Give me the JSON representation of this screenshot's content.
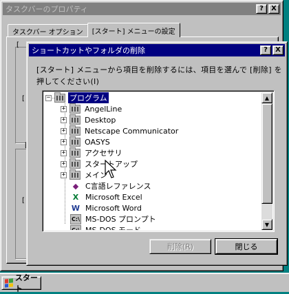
{
  "back_window": {
    "title": "タスクバーのプロパティ",
    "help_btn": "?",
    "close_btn": "X",
    "tabs": [
      {
        "label": "タスクバー オプション",
        "selected": false
      },
      {
        "label": "[スタート] メニューの設定",
        "selected": true
      }
    ],
    "bracket_1": "[",
    "bracket_2": "[",
    "bracket_3": "[",
    "bracket_4": "["
  },
  "dialog": {
    "title": "ショートカットやフォルダの削除",
    "help_btn": "?",
    "close_btn": "X",
    "message": "[スタート] メニューから項目を削除するには、項目を選んで [削除] を押してください(I)",
    "tree_items": [
      {
        "label": "プログラム",
        "expander": "−",
        "icon": "folder-icon",
        "selected": true
      },
      {
        "label": "AngelLine",
        "expander": "+",
        "icon": "folder-icon"
      },
      {
        "label": "Desktop",
        "expander": "+",
        "icon": "folder-icon"
      },
      {
        "label": "Netscape Communicator",
        "expander": "+",
        "icon": "folder-icon"
      },
      {
        "label": "OASYS",
        "expander": "+",
        "icon": "folder-icon"
      },
      {
        "label": "アクセサリ",
        "expander": "+",
        "icon": "folder-icon"
      },
      {
        "label": "スタートアップ",
        "expander": "+",
        "icon": "folder-icon"
      },
      {
        "label": "メイン",
        "expander": "+",
        "icon": "folder-icon"
      },
      {
        "label": "C言語レファレンス",
        "expander": "",
        "icon": "reference-book-icon"
      },
      {
        "label": "Microsoft Excel",
        "expander": "",
        "icon": "excel-icon"
      },
      {
        "label": "Microsoft Word",
        "expander": "",
        "icon": "word-icon"
      },
      {
        "label": "MS-DOS プロンプト",
        "expander": "",
        "icon": "msdos-icon"
      },
      {
        "label": "MS-DOS モード",
        "expander": "",
        "icon": "msdos-icon"
      }
    ],
    "delete_btn": "削除(R)",
    "close_label": "閉じる",
    "scroll_up": "▲",
    "scroll_down": "▼"
  },
  "taskbar": {
    "start_label": "スタート"
  },
  "colors": {
    "desktop": "#008080",
    "face": "#c0c0c0",
    "active_title": "#000080",
    "inactive_title": "#808080"
  }
}
